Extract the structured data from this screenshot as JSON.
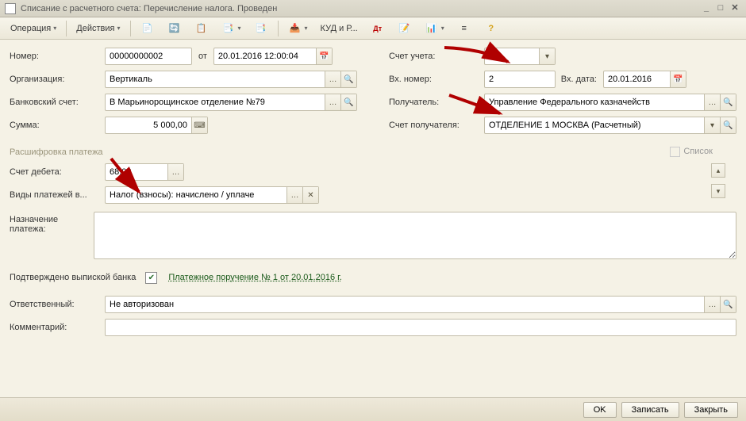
{
  "window": {
    "title": "Списание с расчетного счета: Перечисление налога. Проведен"
  },
  "toolbar": {
    "operation": "Операция",
    "actions": "Действия",
    "kudr": "КУД и Р..."
  },
  "labels": {
    "number": "Номер:",
    "from": "от",
    "org": "Организация:",
    "bankacc": "Банковский счет:",
    "sum": "Сумма:",
    "acct": "Счет учета:",
    "inno": "Вх. номер:",
    "indate": "Вх. дата:",
    "recipient": "Получатель:",
    "recacct": "Счет получателя:",
    "section": "Расшифровка платежа",
    "spisok": "Список",
    "debit": "Счет дебета:",
    "paytype": "Виды платежей в...",
    "purpose": "Назначение платежа:",
    "confirmed": "Подтверждено выпиской банка",
    "responsible": "Ответственный:",
    "comment": "Комментарий:"
  },
  "values": {
    "number": "00000000002",
    "date": "20.01.2016 12:00:04",
    "org": "Вертикаль",
    "bankacc": "В Марьинорощинское отделение №79",
    "sum": "5 000,00",
    "acct": "51",
    "inno": "2",
    "indate": "20.01.2016",
    "recipient": "Управление Федерального казначейств",
    "recacct": "ОТДЕЛЕНИЕ 1 МОСКВА (Расчетный)",
    "debit": "68.02",
    "paytype": "Налог (взносы): начислено / уплаче",
    "link": "Платежное поручение № 1 от 20.01.2016 г.",
    "responsible": "Не авторизован"
  },
  "buttons": {
    "ok": "OK",
    "save": "Записать",
    "close": "Закрыть"
  }
}
